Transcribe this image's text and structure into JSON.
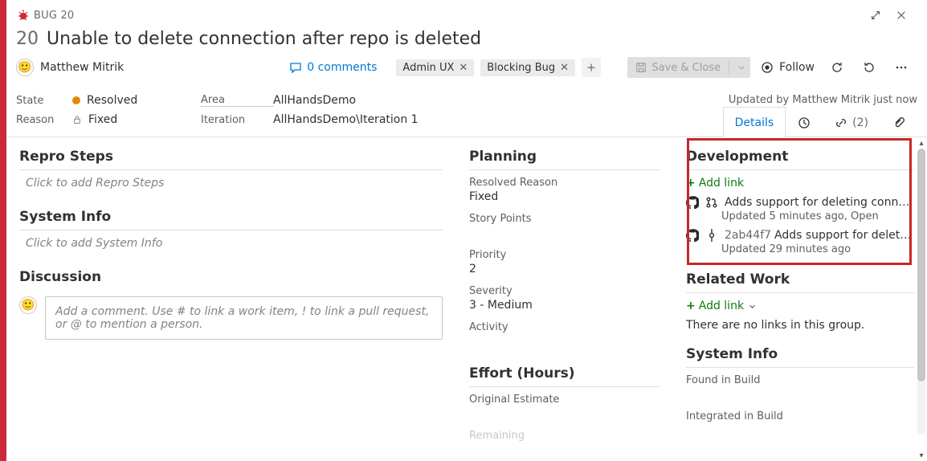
{
  "header": {
    "type_label": "BUG 20",
    "id": "20",
    "title": "Unable to delete connection after repo is deleted"
  },
  "assignee": {
    "name": "Matthew Mitrik"
  },
  "comments": {
    "label": "0 comments"
  },
  "tags": [
    {
      "label": "Admin UX"
    },
    {
      "label": "Blocking Bug"
    }
  ],
  "toolbar": {
    "save_label": "Save & Close",
    "follow_label": "Follow"
  },
  "classification": {
    "state_label": "State",
    "state_value": "Resolved",
    "area_label": "Area",
    "area_value": "AllHandsDemo",
    "reason_label": "Reason",
    "reason_value": "Fixed",
    "iteration_label": "Iteration",
    "iteration_value": "AllHandsDemo\\Iteration 1"
  },
  "updated_text": "Updated by Matthew Mitrik just now",
  "tabs": {
    "details": "Details",
    "links_count": "(2)"
  },
  "left": {
    "repro_h": "Repro Steps",
    "repro_ph": "Click to add Repro Steps",
    "sysinfo_h": "System Info",
    "sysinfo_ph": "Click to add System Info",
    "discussion_h": "Discussion",
    "discussion_ph": "Add a comment. Use # to link a work item, ! to link a pull request, or @ to mention a person."
  },
  "mid": {
    "planning_h": "Planning",
    "resolved_reason_l": "Resolved Reason",
    "resolved_reason_v": "Fixed",
    "story_points_l": "Story Points",
    "priority_l": "Priority",
    "priority_v": "2",
    "severity_l": "Severity",
    "severity_v": "3 - Medium",
    "activity_l": "Activity",
    "effort_h": "Effort (Hours)",
    "original_estimate_l": "Original Estimate",
    "remaining_l": "Remaining"
  },
  "right": {
    "dev_h": "Development",
    "addlink": "Add link",
    "items": [
      {
        "title": "Adds support for deleting connecti…",
        "sub": "Updated 5 minutes ago,  Open"
      },
      {
        "sha": "2ab44f7",
        "title": "Adds support for deleting …",
        "sub": "Updated 29 minutes ago"
      }
    ],
    "related_h": "Related Work",
    "addlink2": "Add link",
    "no_links": "There are no links in this group.",
    "sysinfo_h": "System Info",
    "found_l": "Found in Build",
    "integrated_l": "Integrated in Build"
  }
}
